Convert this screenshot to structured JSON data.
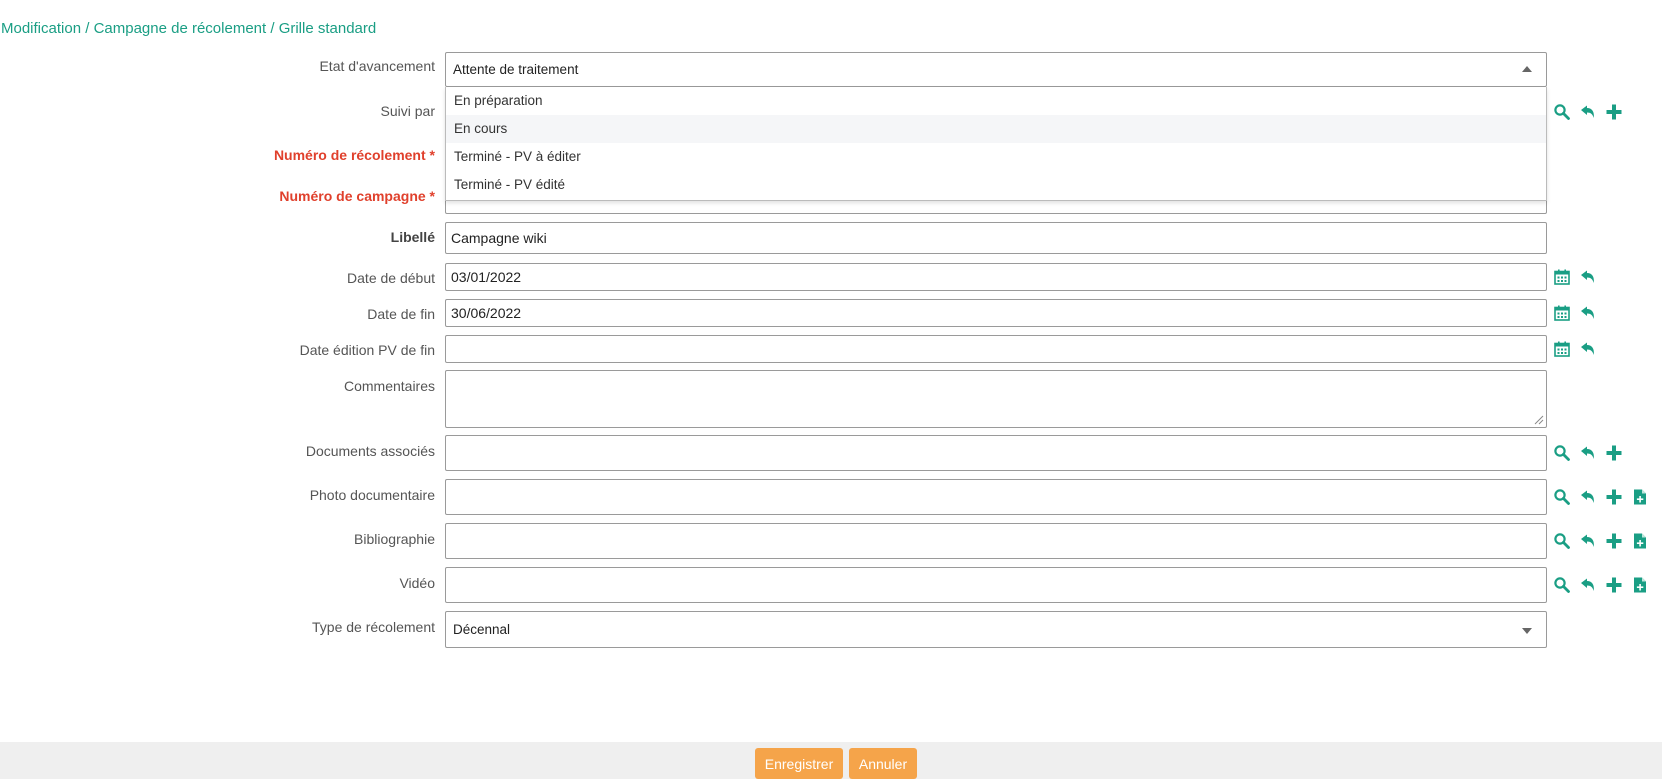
{
  "breadcrumb": {
    "part1": "Modification",
    "sep1": " / ",
    "part2": "Campagne de récolement",
    "sep2": " / ",
    "part3": "Grille standard"
  },
  "form": {
    "etat": {
      "label": "Etat d'avancement",
      "value": "Attente de traitement"
    },
    "suivi": {
      "label": "Suivi par",
      "value": ""
    },
    "numero_recolement": {
      "label": "Numéro de récolement *",
      "value": ""
    },
    "numero_campagne": {
      "label": "Numéro de campagne *",
      "value": ""
    },
    "libelle": {
      "label": "Libellé",
      "value": "Campagne wiki"
    },
    "date_debut": {
      "label": "Date de début",
      "value": "03/01/2022"
    },
    "date_fin": {
      "label": "Date de fin",
      "value": "30/06/2022"
    },
    "date_pv": {
      "label": "Date édition PV de fin",
      "value": ""
    },
    "commentaires": {
      "label": "Commentaires",
      "value": ""
    },
    "documents": {
      "label": "Documents associés",
      "value": ""
    },
    "photo": {
      "label": "Photo documentaire",
      "value": ""
    },
    "bibliographie": {
      "label": "Bibliographie",
      "value": ""
    },
    "video": {
      "label": "Vidéo",
      "value": ""
    },
    "type": {
      "label": "Type de récolement",
      "value": "Décennal"
    }
  },
  "dropdown_options": [
    "En préparation",
    "En cours",
    "Terminé - PV à éditer",
    "Terminé - PV édité"
  ],
  "buttons": {
    "save": "Enregistrer",
    "cancel": "Annuler"
  },
  "icons": {
    "search": "search-icon",
    "undo": "undo-icon",
    "add": "plus-icon",
    "calendar": "calendar-icon",
    "file_add": "file-add-icon"
  },
  "colors": {
    "accent": "#1a9e84",
    "required": "#e0402c",
    "button": "#f5a44a",
    "footer": "#efefef"
  }
}
